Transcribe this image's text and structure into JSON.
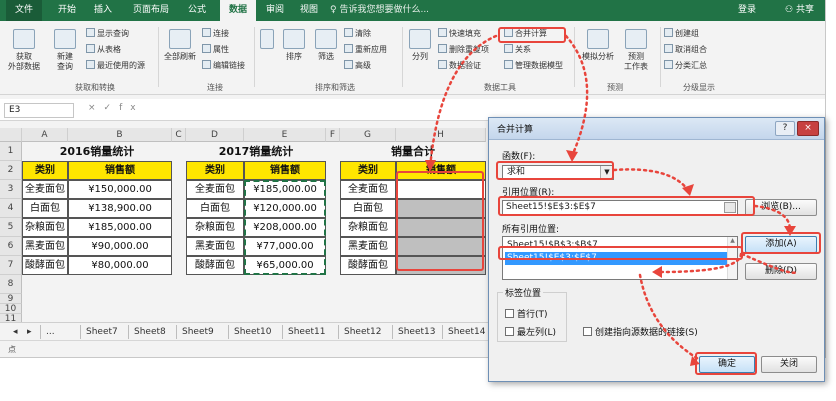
{
  "ribbon_tabs": [
    "文件",
    "开始",
    "插入",
    "页面布局",
    "公式",
    "数据",
    "审阅",
    "视图"
  ],
  "active_tab": "数据",
  "tell_me": "告诉我您想要做什么...",
  "login": "登录",
  "share": "共享",
  "ribbon": {
    "get_external_data": "获取\n外部数据",
    "new_query": "新建\n查询",
    "show_query": "显示查询",
    "from_table": "从表格",
    "recent_sources": "最近使用的源",
    "group_get_transform": "获取和转换",
    "refresh_all": "全部刷新",
    "connections": "连接",
    "properties": "属性",
    "edit_links": "编辑链接",
    "group_connections": "连接",
    "sort": "排序",
    "filter": "筛选",
    "clear": "清除",
    "reapply": "重新应用",
    "advanced": "高级",
    "group_sort_filter": "排序和筛选",
    "split": "分列",
    "flash_fill": "快速填充",
    "remove_dup": "删除重复项",
    "data_validation": "数据验证",
    "consolidate": "合并计算",
    "relations": "关系",
    "manage_model": "管理数据模型",
    "group_data_tools": "数据工具",
    "whatif": "模拟分析",
    "forecast_sheet": "预测\n工作表",
    "group_forecast": "预测",
    "group_create": "创建组",
    "ungroup": "取消组合",
    "subtotal": "分类汇总",
    "group_outline": "分级显示"
  },
  "name_box": "E3",
  "fx": "fx",
  "col_headers": [
    "A",
    "B",
    "C",
    "D",
    "E",
    "F",
    "G",
    "H"
  ],
  "row_headers": [
    "1",
    "2",
    "3",
    "4",
    "5",
    "6",
    "7",
    "8",
    "9",
    "10",
    "11"
  ],
  "table1": {
    "title": "2016销量统计",
    "headers": [
      "类别",
      "销售额"
    ],
    "rows": [
      [
        "全麦面包",
        "¥150,000.00"
      ],
      [
        "白面包",
        "¥138,900.00"
      ],
      [
        "杂粮面包",
        "¥185,000.00"
      ],
      [
        "黑麦面包",
        "¥90,000.00"
      ],
      [
        "酸酵面包",
        "¥80,000.00"
      ]
    ]
  },
  "table2": {
    "title": "2017销量统计",
    "headers": [
      "类别",
      "销售额"
    ],
    "rows": [
      [
        "全麦面包",
        "¥185,000.00"
      ],
      [
        "白面包",
        "¥120,000.00"
      ],
      [
        "杂粮面包",
        "¥208,000.00"
      ],
      [
        "黑麦面包",
        "¥77,000.00"
      ],
      [
        "酸酵面包",
        "¥65,000.00"
      ]
    ]
  },
  "table3": {
    "title": "销量合计",
    "headers": [
      "类别",
      "销售额"
    ],
    "rows": [
      "全麦面包",
      "白面包",
      "杂粮面包",
      "黑麦面包",
      "酸酵面包"
    ]
  },
  "sheet_tabs": [
    "...",
    "Sheet7",
    "Sheet8",
    "Sheet9",
    "Sheet10",
    "Sheet11",
    "Sheet12",
    "Sheet13",
    "Sheet14"
  ],
  "status": "点",
  "dialog": {
    "title": "合并计算",
    "function_label": "函数(F):",
    "function_value": "求和",
    "ref_label": "引用位置(R):",
    "ref_value": "Sheet15!$E$3:$E$7",
    "browse": "浏览(B)...",
    "all_refs_label": "所有引用位置:",
    "all_refs": [
      "Sheet15!$B$3:$B$7",
      "Sheet15!$E$3:$E$7"
    ],
    "add": "添加(A)",
    "delete": "删除(D)",
    "label_pos": "标签位置",
    "first_row": "首行(T)",
    "left_col": "最左列(L)",
    "create_links": "创建指向源数据的链接(S)",
    "ok": "确定",
    "close": "关闭",
    "help": "?",
    "x": "×"
  },
  "colors": {
    "excel_green": "#217346",
    "header_yellow": "#ffe600",
    "callout_red": "#e8453c",
    "selection_blue": "#3399ff"
  }
}
